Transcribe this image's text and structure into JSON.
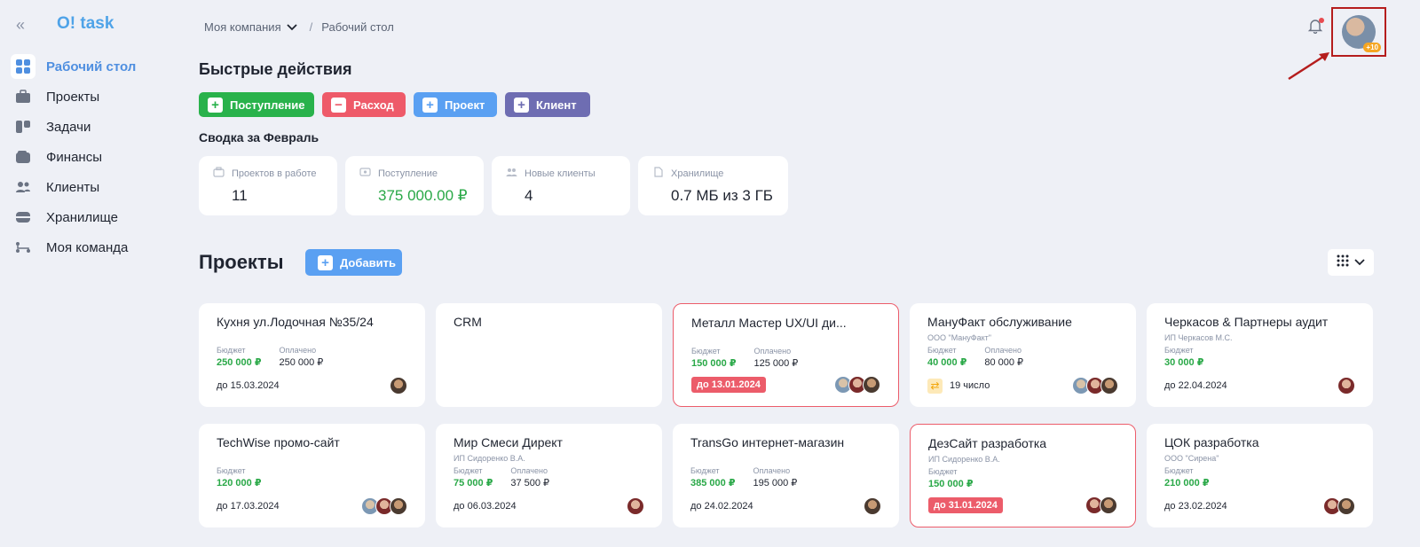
{
  "app": {
    "logo": "O! task"
  },
  "sidebar": {
    "items": [
      {
        "label": "Рабочий стол",
        "icon": "dashboard-grid-icon",
        "active": true
      },
      {
        "label": "Проекты",
        "icon": "briefcase-icon"
      },
      {
        "label": "Задачи",
        "icon": "kanban-icon"
      },
      {
        "label": "Финансы",
        "icon": "wallet-icon"
      },
      {
        "label": "Клиенты",
        "icon": "users-icon"
      },
      {
        "label": "Хранилище",
        "icon": "storage-box-icon"
      },
      {
        "label": "Моя команда",
        "icon": "team-tree-icon"
      }
    ]
  },
  "header": {
    "company": "Моя компания",
    "current_page": "Рабочий стол",
    "avatar_badge": "+10"
  },
  "quick_actions": {
    "title": "Быстрые действия",
    "buttons": [
      {
        "label": "Поступление",
        "icon": "plus",
        "color": "#29b24b"
      },
      {
        "label": "Расход",
        "icon": "minus",
        "color": "#ee5a69"
      },
      {
        "label": "Проект",
        "icon": "plus",
        "color": "#5aa0f2"
      },
      {
        "label": "Клиент",
        "icon": "plus",
        "color": "#6e6db2"
      }
    ]
  },
  "summary": {
    "title": "Сводка за Февраль",
    "stats": [
      {
        "label": "Проектов в работе",
        "value": "11"
      },
      {
        "label": "Поступление",
        "value": "375 000.00 ₽"
      },
      {
        "label": "Новые клиенты",
        "value": "4"
      },
      {
        "label": "Хранилище",
        "value": "0.7 МБ из 3 ГБ"
      }
    ]
  },
  "projects": {
    "title": "Проекты",
    "add_label": "Добавить",
    "budget_label": "Бюджет",
    "paid_label": "Оплачено",
    "cards": [
      {
        "title": "Кухня ул.Лодочная №35/24",
        "client": "",
        "budget": "250 000 ₽",
        "paid": "250 000 ₽",
        "deadline": "до 15.03.2024",
        "overdue": false,
        "avatars": [
          "a1"
        ]
      },
      {
        "title": "CRM",
        "client": "",
        "budget": "",
        "paid": "",
        "deadline": "",
        "overdue": false,
        "avatars": []
      },
      {
        "title": "Металл Мастер UX/UI ди...",
        "client": "",
        "budget": "150 000 ₽",
        "paid": "125 000 ₽",
        "deadline": "до 13.01.2024",
        "overdue": true,
        "avatars": [
          "a3",
          "a2",
          "a1"
        ]
      },
      {
        "title": "МануФакт обслуживание",
        "client": "ООО \"МануФакт\"",
        "budget": "40 000 ₽",
        "paid": "80 000 ₽",
        "recurring": "19 число",
        "overdue": false,
        "avatars": [
          "a3",
          "a2",
          "a1"
        ]
      },
      {
        "title": "Черкасов & Партнеры аудит",
        "client": "ИП Черкасов М.С.",
        "budget": "30 000 ₽",
        "paid": "",
        "deadline": "до 22.04.2024",
        "overdue": false,
        "avatars": [
          "a2"
        ]
      },
      {
        "title": "TechWise промо-сайт",
        "client": "",
        "budget": "120 000 ₽",
        "paid": "",
        "deadline": "до 17.03.2024",
        "overdue": false,
        "avatars": [
          "a3",
          "a2",
          "a1"
        ]
      },
      {
        "title": "Мир Смеси Директ",
        "client": "ИП Сидоренко В.А.",
        "budget": "75 000 ₽",
        "paid": "37 500 ₽",
        "deadline": "до 06.03.2024",
        "overdue": false,
        "avatars": [
          "a2"
        ]
      },
      {
        "title": "TransGo интернет-магазин",
        "client": "",
        "budget": "385 000 ₽",
        "paid": "195 000 ₽",
        "deadline": "до 24.02.2024",
        "overdue": false,
        "avatars": [
          "a1"
        ]
      },
      {
        "title": "ДезСайт разработка",
        "client": "ИП Сидоренко В.А.",
        "budget": "150 000 ₽",
        "paid": "",
        "deadline": "до 31.01.2024",
        "overdue": true,
        "avatars": [
          "a2",
          "a1"
        ]
      },
      {
        "title": "ЦОК разработка",
        "client": "ООО \"Сирена\"",
        "budget": "210 000 ₽",
        "paid": "",
        "deadline": "до 23.02.2024",
        "overdue": false,
        "avatars": [
          "a2",
          "a1"
        ]
      }
    ]
  }
}
